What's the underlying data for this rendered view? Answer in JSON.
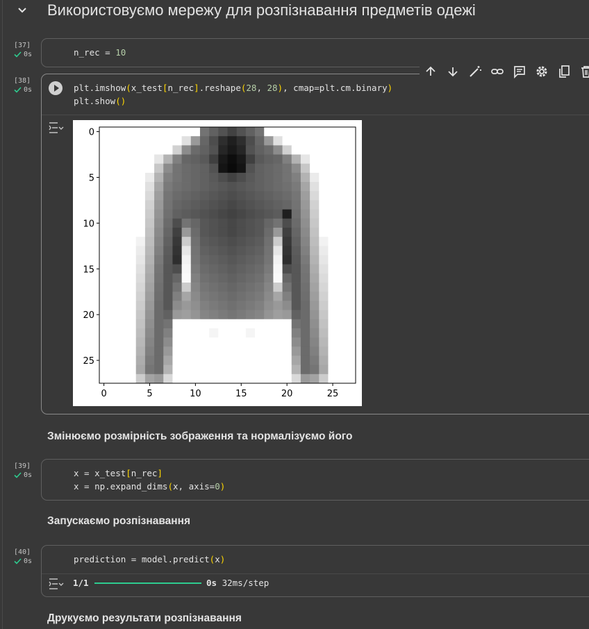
{
  "section": {
    "title": "Використовуємо мережу для розпізнавання предметів одежі"
  },
  "cells": [
    {
      "exec_count": "[37]",
      "status": "0s",
      "code": [
        "n_rec = 10"
      ]
    },
    {
      "exec_count": "[38]",
      "status": "0s",
      "code": [
        "plt.imshow(x_test[n_rec].reshape(28, 28), cmap=plt.cm.binary)",
        "plt.show()"
      ]
    },
    {
      "exec_count": "[39]",
      "status": "0s",
      "code": [
        "x = x_test[n_rec]",
        "x = np.expand_dims(x, axis=0)"
      ]
    },
    {
      "exec_count": "[40]",
      "status": "0s",
      "code": [
        "prediction = model.predict(x)"
      ]
    }
  ],
  "toolbar": {
    "icons": [
      "arrow-up-icon",
      "arrow-down-icon",
      "magic-wand-icon",
      "link-icon",
      "comment-icon",
      "gear-icon",
      "mirror-cell-icon",
      "trash-icon"
    ]
  },
  "markdown": {
    "reshape": "Змінюємо розмірність зображення та нормалізуємо його",
    "run": "Запускаємо розпізнавання",
    "print": "Друкуємо результати розпізнавання"
  },
  "progress": {
    "step": "1/1",
    "fraction": 1.0,
    "time": "0s",
    "rate": "32ms/step"
  },
  "chart_data": {
    "type": "heatmap",
    "title": "",
    "cmap": "binary",
    "x_ticks": [
      "0",
      "5",
      "10",
      "15",
      "20",
      "25"
    ],
    "y_ticks": [
      "0",
      "5",
      "10",
      "15",
      "20",
      "25"
    ],
    "xlim": [
      -0.5,
      27.5
    ],
    "ylim": [
      27.5,
      -0.5
    ],
    "rows": 28,
    "cols": 28,
    "values": [
      [
        0,
        0,
        0,
        0,
        0,
        0,
        0,
        0,
        0,
        0,
        0,
        55,
        62,
        68,
        74,
        68,
        62,
        55,
        0,
        0,
        0,
        0,
        0,
        0,
        0,
        0,
        0,
        0
      ],
      [
        0,
        0,
        0,
        0,
        0,
        0,
        0,
        0,
        0,
        12,
        40,
        60,
        70,
        82,
        88,
        82,
        70,
        60,
        40,
        12,
        0,
        0,
        0,
        0,
        0,
        0,
        0,
        0
      ],
      [
        0,
        0,
        0,
        0,
        0,
        0,
        0,
        0,
        18,
        45,
        58,
        62,
        68,
        85,
        90,
        85,
        68,
        62,
        58,
        45,
        18,
        0,
        0,
        0,
        0,
        0,
        0,
        0
      ],
      [
        0,
        0,
        0,
        0,
        0,
        0,
        10,
        30,
        50,
        60,
        62,
        65,
        75,
        90,
        95,
        90,
        75,
        65,
        62,
        60,
        50,
        30,
        10,
        0,
        0,
        0,
        0,
        0
      ],
      [
        0,
        0,
        0,
        0,
        0,
        0,
        22,
        45,
        55,
        58,
        60,
        62,
        68,
        92,
        96,
        92,
        68,
        62,
        60,
        58,
        55,
        45,
        22,
        0,
        0,
        0,
        0,
        0
      ],
      [
        0,
        0,
        0,
        0,
        0,
        8,
        30,
        50,
        55,
        58,
        60,
        62,
        65,
        70,
        74,
        70,
        65,
        62,
        60,
        58,
        55,
        50,
        30,
        8,
        0,
        0,
        0,
        0
      ],
      [
        0,
        0,
        0,
        0,
        0,
        12,
        35,
        52,
        56,
        58,
        60,
        62,
        64,
        66,
        68,
        66,
        64,
        62,
        60,
        58,
        56,
        52,
        35,
        12,
        0,
        0,
        0,
        0
      ],
      [
        0,
        0,
        0,
        0,
        0,
        15,
        38,
        54,
        58,
        60,
        62,
        64,
        66,
        68,
        70,
        68,
        66,
        64,
        62,
        60,
        58,
        54,
        38,
        15,
        0,
        0,
        0,
        0
      ],
      [
        0,
        0,
        0,
        0,
        0,
        18,
        40,
        55,
        60,
        62,
        64,
        66,
        68,
        70,
        72,
        70,
        68,
        66,
        64,
        62,
        60,
        55,
        40,
        18,
        0,
        0,
        0,
        0
      ],
      [
        0,
        0,
        0,
        0,
        0,
        20,
        42,
        56,
        62,
        64,
        66,
        68,
        70,
        72,
        74,
        72,
        70,
        68,
        66,
        64,
        88,
        56,
        42,
        20,
        0,
        0,
        0,
        0
      ],
      [
        0,
        0,
        0,
        0,
        0,
        22,
        44,
        58,
        70,
        55,
        60,
        66,
        68,
        70,
        72,
        70,
        68,
        66,
        60,
        55,
        70,
        58,
        44,
        22,
        0,
        0,
        0,
        0
      ],
      [
        0,
        0,
        0,
        0,
        0,
        24,
        46,
        60,
        75,
        40,
        58,
        66,
        68,
        70,
        72,
        70,
        68,
        66,
        58,
        40,
        75,
        60,
        46,
        24,
        0,
        0,
        0,
        0
      ],
      [
        0,
        0,
        0,
        0,
        5,
        26,
        48,
        62,
        78,
        20,
        56,
        64,
        66,
        68,
        70,
        68,
        66,
        64,
        56,
        20,
        78,
        62,
        48,
        26,
        5,
        0,
        0,
        0
      ],
      [
        0,
        0,
        0,
        0,
        8,
        28,
        50,
        64,
        80,
        10,
        55,
        62,
        64,
        66,
        68,
        66,
        64,
        62,
        55,
        10,
        80,
        64,
        50,
        28,
        8,
        0,
        0,
        0
      ],
      [
        0,
        0,
        0,
        0,
        10,
        30,
        52,
        65,
        82,
        5,
        54,
        60,
        62,
        64,
        66,
        64,
        62,
        60,
        54,
        5,
        82,
        65,
        52,
        30,
        10,
        0,
        0,
        0
      ],
      [
        0,
        0,
        0,
        0,
        12,
        32,
        54,
        66,
        70,
        3,
        52,
        58,
        60,
        62,
        64,
        62,
        60,
        58,
        52,
        3,
        70,
        66,
        54,
        32,
        12,
        0,
        0,
        0
      ],
      [
        0,
        0,
        0,
        0,
        14,
        34,
        55,
        66,
        60,
        2,
        50,
        56,
        58,
        60,
        62,
        60,
        58,
        56,
        50,
        2,
        60,
        66,
        55,
        34,
        14,
        0,
        0,
        0
      ],
      [
        0,
        0,
        0,
        0,
        16,
        36,
        56,
        66,
        55,
        20,
        48,
        54,
        56,
        58,
        60,
        58,
        56,
        54,
        48,
        20,
        55,
        66,
        56,
        36,
        16,
        0,
        0,
        0
      ],
      [
        0,
        0,
        0,
        0,
        18,
        38,
        57,
        66,
        50,
        35,
        46,
        52,
        54,
        56,
        58,
        56,
        54,
        52,
        46,
        35,
        50,
        66,
        57,
        38,
        18,
        0,
        0,
        0
      ],
      [
        0,
        0,
        0,
        0,
        20,
        40,
        58,
        66,
        45,
        40,
        44,
        50,
        52,
        54,
        56,
        54,
        52,
        50,
        44,
        40,
        45,
        66,
        58,
        40,
        20,
        0,
        0,
        0
      ],
      [
        0,
        0,
        0,
        0,
        22,
        42,
        58,
        62,
        40,
        38,
        42,
        48,
        50,
        52,
        54,
        52,
        50,
        48,
        42,
        38,
        40,
        62,
        58,
        42,
        22,
        0,
        0,
        0
      ],
      [
        0,
        0,
        0,
        0,
        24,
        44,
        58,
        55,
        0,
        0,
        0,
        0,
        0,
        0,
        0,
        0,
        0,
        0,
        0,
        0,
        0,
        55,
        58,
        44,
        24,
        0,
        0,
        0
      ],
      [
        0,
        0,
        0,
        0,
        26,
        46,
        58,
        50,
        0,
        0,
        0,
        0,
        4,
        0,
        0,
        0,
        4,
        0,
        0,
        0,
        0,
        50,
        58,
        46,
        26,
        0,
        0,
        0
      ],
      [
        0,
        0,
        0,
        0,
        28,
        48,
        58,
        45,
        0,
        0,
        0,
        0,
        0,
        0,
        0,
        0,
        0,
        0,
        0,
        0,
        0,
        45,
        58,
        48,
        28,
        0,
        0,
        0
      ],
      [
        0,
        0,
        0,
        0,
        30,
        50,
        58,
        40,
        0,
        0,
        0,
        0,
        0,
        0,
        0,
        0,
        0,
        0,
        0,
        0,
        0,
        40,
        58,
        50,
        30,
        0,
        0,
        0
      ],
      [
        0,
        0,
        0,
        0,
        32,
        52,
        58,
        35,
        0,
        0,
        0,
        0,
        0,
        0,
        0,
        0,
        0,
        0,
        0,
        0,
        0,
        35,
        58,
        52,
        32,
        0,
        0,
        0
      ],
      [
        0,
        0,
        0,
        0,
        34,
        54,
        58,
        30,
        0,
        0,
        0,
        0,
        0,
        0,
        0,
        0,
        0,
        0,
        0,
        0,
        0,
        30,
        58,
        54,
        34,
        0,
        0,
        0
      ],
      [
        0,
        0,
        0,
        0,
        20,
        36,
        40,
        15,
        0,
        0,
        0,
        0,
        0,
        0,
        0,
        0,
        0,
        0,
        0,
        0,
        0,
        15,
        40,
        36,
        20,
        0,
        0,
        0
      ]
    ]
  }
}
